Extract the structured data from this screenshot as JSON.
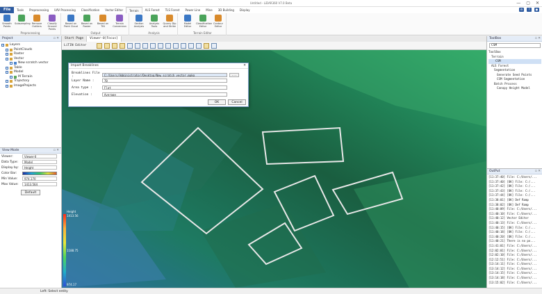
{
  "window": {
    "title": "Untitled - LiDAR360 V7.0 Beta",
    "controls": [
      "—",
      "▢",
      "✕"
    ]
  },
  "menu": {
    "file": "File",
    "tabs": [
      "Tools",
      "Preprocessing",
      "UAV Processing",
      "Classification",
      "Vector Editor",
      "Terrain",
      "ALS Forest",
      "TLS Forest",
      "Power Line",
      "Mine",
      "3D Building",
      "Display"
    ],
    "active": "Terrain"
  },
  "ribbon": {
    "groups": [
      {
        "label": "Preprocessing",
        "buttons": [
          "Smooth Points",
          "Subsampling",
          "Remove Outliers",
          "Classify Ground Points"
        ]
      },
      {
        "label": "Output",
        "buttons": [
          "Based on Point Cloud",
          "Based on Raster",
          "Based on TIN",
          "Terrain Conversion"
        ]
      },
      {
        "label": "Analysis",
        "buttons": [
          "Section Analysis",
          "Analysis Tools",
          "Quarry Dip and Strike"
        ]
      },
      {
        "label": "Terrain Editor",
        "buttons": [
          "Model Editor",
          "Classification Editor",
          "Contour Editor"
        ]
      }
    ]
  },
  "project": {
    "title": "Project",
    "tree": [
      "Layers",
      "PointClouds",
      "Raster",
      "Vector",
      "New scratch vector",
      "Table",
      "Model",
      "M Terrain",
      "Trajectory",
      "ImageProjects"
    ]
  },
  "view_mode": {
    "title": "View Mode",
    "viewer_label": "Viewer:",
    "viewer_value": "Viewer-0",
    "data_type_label": "Data Type:",
    "data_type_value": "Model",
    "display_by_label": "Display by:",
    "display_by_value": "Height",
    "color_bar_label": "Color Bar:",
    "min_label": "Min Value:",
    "min_value": "974.170",
    "max_label": "Max Value:",
    "max_value": "1413.564",
    "default_button": "Default"
  },
  "viewer": {
    "tabs": [
      "Start Page",
      "Viewer-0[Focus]"
    ],
    "active_tab": "Viewer-0[Focus]",
    "editor_name": "LiTIN Editor",
    "legend": {
      "title": "Height",
      "top": "1413.56",
      "mid": "1188.75",
      "bottom": "974.17"
    }
  },
  "dialog": {
    "title": "Import Breaklines",
    "breaklines_label": "Breaklines File :",
    "breaklines_value": "C:/Users/Administrator/Desktop/New scratch vector.mpkg",
    "browse": "...",
    "layer_label": "Layer Name :",
    "layer_value": "70",
    "area_label": "Area type :",
    "area_value": "Flat",
    "elev_label": "Elevation :",
    "elev_value": "Average",
    "ok": "OK",
    "cancel": "Cancel"
  },
  "toolbox": {
    "title": "ToolBox",
    "search": "CSM",
    "tree": [
      "ToolBox",
      "Terrain",
      "CSM",
      "ALS Forest",
      "Segmentation",
      "Generate Seed Points",
      "CSM Segmentation",
      "Batch Process",
      "Canopy Height Model"
    ]
  },
  "output": {
    "title": "OutPut",
    "lines": [
      "[11:37:40] File: C:/Users/...",
      "[11:37:40] [OK]  File: C:/...",
      "[11:37:42] [OK]  File: C:/...",
      "[11:37:43] [OK]  File: C:/...",
      "[11:37:44] [OK]  File: C:/...",
      "[11:38:01] [OK]  Def Ramp",
      "[11:38:02] [OK]  Def Ramp",
      "[11:40:09] File: C:/Users/...",
      "[11:40:10] File: C:/Users/...",
      "[11:40:12] Vector Editor",
      "[11:40:13] File: C:/Users/...",
      "[11:40:15] [OK]  File: C:/...",
      "[11:40:18] [OK]  File: C:/...",
      "[11:40:20] [OK]  File: C:/...",
      "[11:40:21] There is no po...",
      "[11:41:01] File: C:/Users/...",
      "[12:02:01] File: C:/Users/...",
      "[12:02:10] File: C:/Users/...",
      "[12:12:51] File: C:/Users/...",
      "[13:14:11] File: C:/Users/...",
      "[13:14:12] File: C:/Users/...",
      "[13:14:15] File: C:/Users/...",
      "[13:14:18] File: C:/Users/...",
      "[13:15:02] File: C:/Users/..."
    ]
  },
  "status": {
    "text": "Left: Select entity"
  },
  "colors": {
    "accent": "#2c5aa0",
    "terrain": "#1b5e43",
    "breakline": "#e8e8e8"
  }
}
